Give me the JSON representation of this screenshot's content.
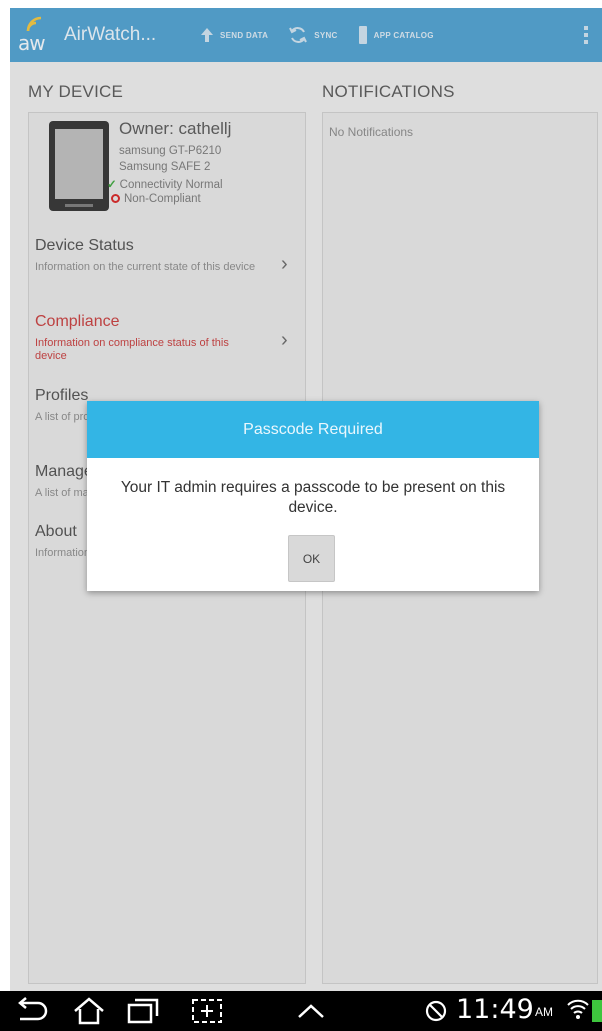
{
  "colors": {
    "actionbar": "#4b9fd0",
    "dialog_header": "#33b5e5",
    "noncompliant": "#d62020",
    "compliance_text": "#c73a3a",
    "connectivity_check": "#3aa53a",
    "battery": "#3ec63e"
  },
  "actionbar": {
    "logo_text": "aw",
    "app_title": "AirWatch...",
    "send_data": "SEND DATA",
    "sync": "SYNC",
    "app_catalog": "APP CATALOG"
  },
  "my_device": {
    "heading": "MY DEVICE",
    "owner": "Owner: cathellj",
    "model": "samsung GT-P6210",
    "safe": "Samsung SAFE 2",
    "connectivity": "Connectivity Normal",
    "compliance_state": "Non-Compliant",
    "items": [
      {
        "title": "Device Status",
        "desc": "Information on the current state of this device"
      },
      {
        "title": "Compliance",
        "desc": "Information on compliance status of this device"
      },
      {
        "title": "Profiles",
        "desc": "A list of profiles installed on this device"
      },
      {
        "title": "Managed Apps",
        "desc": "A list of managed applications"
      },
      {
        "title": "About",
        "desc": "Information about this application"
      }
    ]
  },
  "notifications": {
    "heading": "NOTIFICATIONS",
    "empty_text": "No Notifications"
  },
  "dialog": {
    "title": "Passcode Required",
    "message": "Your IT admin requires a passcode to be present on this device.",
    "ok_label": "OK"
  },
  "statusbar": {
    "time": "11:49",
    "ampm": "AM",
    "icons": [
      "back-icon",
      "home-icon",
      "recent-apps-icon",
      "screenshot-icon",
      "chevron-up-icon",
      "sync-off-icon",
      "wifi-icon",
      "battery-icon"
    ]
  }
}
